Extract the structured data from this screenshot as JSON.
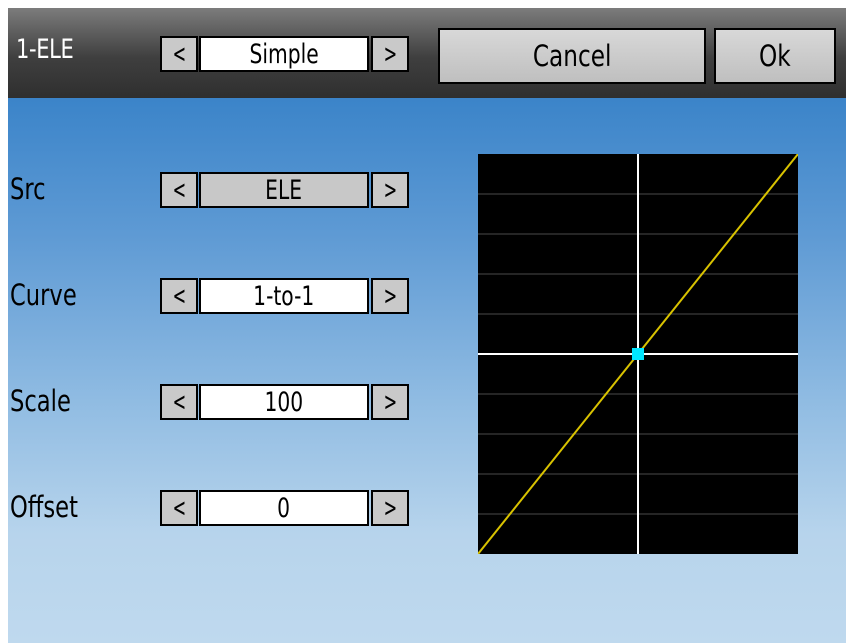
{
  "header": {
    "title": "1-ELE",
    "mode_value": "Simple",
    "cancel_label": "Cancel",
    "ok_label": "Ok"
  },
  "arrows": {
    "left": "<",
    "right": ">"
  },
  "fields": [
    {
      "label": "Src",
      "value": "ELE"
    },
    {
      "label": "Curve",
      "value": "1-to-1"
    },
    {
      "label": "Scale",
      "value": "100"
    },
    {
      "label": "Offset",
      "value": "0"
    }
  ],
  "colors": {
    "header_top": "#7c7c7c",
    "header_bottom": "#2f2f2f",
    "background_top": "#3b84c9",
    "background_bottom": "#bfd9ee",
    "curve": "#d8c200",
    "marker": "#00e5ff",
    "graph_background": "#000000",
    "grid": "#4a4a4a",
    "axis": "#ffffff"
  },
  "graph": {
    "curve_type": "linear",
    "x_range": [
      -100,
      100
    ],
    "y_range": [
      -100,
      100
    ],
    "curve_points": [
      [
        -100,
        -100
      ],
      [
        100,
        100
      ]
    ],
    "current_input": 0,
    "current_output": 0
  }
}
